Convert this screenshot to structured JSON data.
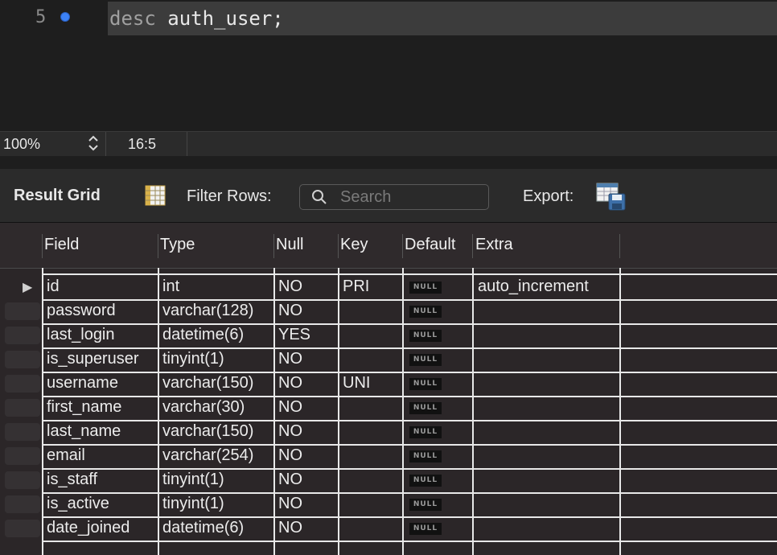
{
  "editor": {
    "line_number": "5",
    "keyword": "desc",
    "statement": " auth_user;"
  },
  "status": {
    "zoom": "100%",
    "cursor": "16:5"
  },
  "toolbar": {
    "result_grid_label": "Result Grid",
    "filter_label": "Filter Rows:",
    "search_placeholder": "Search",
    "export_label": "Export:"
  },
  "grid": {
    "columns": [
      "Field",
      "Type",
      "Null",
      "Key",
      "Default",
      "Extra"
    ],
    "null_label": "NULL",
    "rows": [
      {
        "field": "id",
        "type": "int",
        "null": "NO",
        "key": "PRI",
        "extra": "auto_increment"
      },
      {
        "field": "password",
        "type": "varchar(128)",
        "null": "NO",
        "key": "",
        "extra": ""
      },
      {
        "field": "last_login",
        "type": "datetime(6)",
        "null": "YES",
        "key": "",
        "extra": ""
      },
      {
        "field": "is_superuser",
        "type": "tinyint(1)",
        "null": "NO",
        "key": "",
        "extra": ""
      },
      {
        "field": "username",
        "type": "varchar(150)",
        "null": "NO",
        "key": "UNI",
        "extra": ""
      },
      {
        "field": "first_name",
        "type": "varchar(30)",
        "null": "NO",
        "key": "",
        "extra": ""
      },
      {
        "field": "last_name",
        "type": "varchar(150)",
        "null": "NO",
        "key": "",
        "extra": ""
      },
      {
        "field": "email",
        "type": "varchar(254)",
        "null": "NO",
        "key": "",
        "extra": ""
      },
      {
        "field": "is_staff",
        "type": "tinyint(1)",
        "null": "NO",
        "key": "",
        "extra": ""
      },
      {
        "field": "is_active",
        "type": "tinyint(1)",
        "null": "NO",
        "key": "",
        "extra": ""
      },
      {
        "field": "date_joined",
        "type": "datetime(6)",
        "null": "NO",
        "key": "",
        "extra": ""
      }
    ]
  }
}
